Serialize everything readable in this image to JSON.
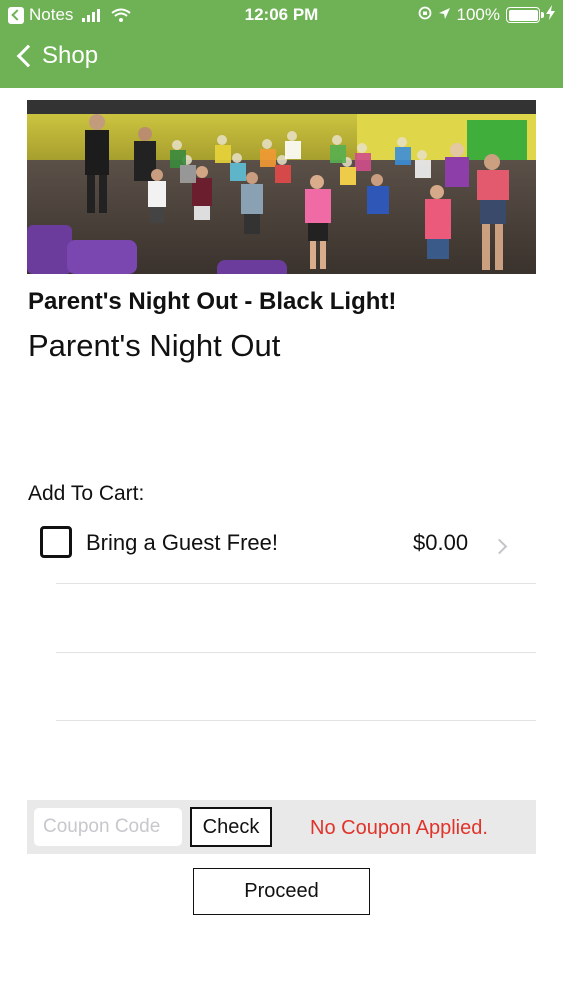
{
  "status_bar": {
    "back_app": "Notes",
    "time": "12:06 PM",
    "battery": "100%"
  },
  "nav": {
    "back_label": "Shop"
  },
  "product": {
    "title": "Parent's Night Out - Black Light!",
    "subtitle": "Parent's Night Out"
  },
  "cart": {
    "heading": "Add To Cart:",
    "items": [
      {
        "label": "Bring a Guest Free!",
        "price": "$0.00",
        "checked": false
      }
    ]
  },
  "coupon": {
    "placeholder": "Coupon Code",
    "value": "",
    "check_label": "Check",
    "status": "No Coupon Applied."
  },
  "proceed_label": "Proceed",
  "colors": {
    "nav_green": "#6fb155",
    "coupon_status_red": "#e0342b",
    "coupon_bar_bg": "#e9e9ea"
  }
}
